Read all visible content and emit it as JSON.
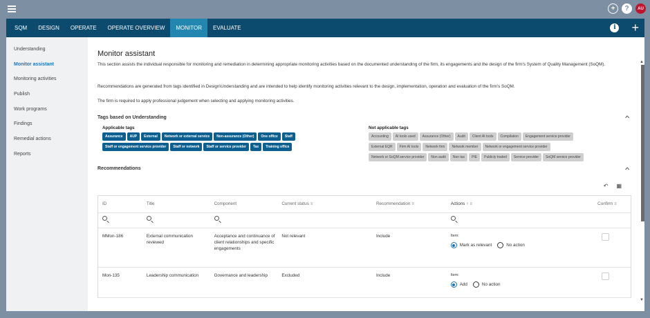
{
  "topbar": {
    "add_icon": "+",
    "help_icon": "?",
    "user_initials": "AU"
  },
  "nav": {
    "tabs": [
      "SQM",
      "DESIGN",
      "OPERATE",
      "OPERATE OVERVIEW",
      "MONITOR",
      "EVALUATE"
    ],
    "active_tab": "MONITOR",
    "info_icon": "i",
    "plus_icon": "+"
  },
  "sidebar": {
    "items": [
      "Understanding",
      "Monitor assistant",
      "Monitoring activities",
      "Publish",
      "Work programs",
      "Findings",
      "Remedial actions",
      "Reports"
    ],
    "active_item": "Monitor assistant"
  },
  "page": {
    "title": "Monitor assistant",
    "para1": "This section assists the individual responsible for monitoring and remediation in determining appropriate monitoring activities based on the documented understanding of the firm, its engagements and the design of the firm's System of Quality Management (SoQM).",
    "para2": "Recommendations are generated from tags identified in Design\\Understanding and are intended to help identify monitoring activities relevant to the design, implementation, operation and evaluation of the firm's SoQM.",
    "para3": "The firm is required to apply professional judgement when selecting and applying monitoring activities."
  },
  "tags": {
    "section_title": "Tags based on Understanding",
    "applicable_label": "Applicable tags",
    "applicable_row1": [
      "Assurance",
      "AUP",
      "External",
      "Network or external service",
      "Non-assurance (Other)",
      "One office",
      "Staff"
    ],
    "applicable_row2": [
      "Staff or engagement service provider",
      "Staff or network",
      "Staff or service provider",
      "Tax",
      "Training office"
    ],
    "not_applicable_label": "Not applicable tags",
    "na_row1": [
      "Accounting",
      "AI tools used",
      "Assurance (Other)",
      "Audit",
      "Client AI tools",
      "Compilation",
      "Engagement service provider"
    ],
    "na_row2": [
      "External EQR",
      "Firm AI tools",
      "Network firm",
      "Network member",
      "Network or engagement service provider"
    ],
    "na_row3": [
      "Network or SoQM service provider",
      "Non audit",
      "Non tax",
      "PIE",
      "Publicly traded",
      "Service provider",
      "SoQM service provider"
    ]
  },
  "recommendations": {
    "section_title": "Recommendations",
    "columns": {
      "id": "ID",
      "title": "Title",
      "component": "Component",
      "status": "Current status",
      "recommendation": "Recommendation",
      "actions": "Actions",
      "confirm": "Confirm"
    },
    "rows": [
      {
        "id": "MMon-186",
        "title": "External communication reviewed",
        "component": "Acceptance and continuance of client relationships and specific engagements",
        "status": "Not relevant",
        "recommendation": "Include",
        "item_label": "Item:",
        "option1": "Mark as relevant",
        "option2": "No action"
      },
      {
        "id": "Mon-135",
        "title": "Leadership communication",
        "component": "Governance and leadership",
        "status": "Excluded",
        "recommendation": "Include",
        "item_label": "Item:",
        "option1": "Add",
        "option2": "No action"
      }
    ]
  },
  "colors": {
    "navbar": "#0c4a6e",
    "active_tab": "#2386b0",
    "applicable_tag": "#0c5f8f",
    "not_applicable_tag": "#cfcfcf",
    "accent": "#1f73b7",
    "user_badge": "#c0152f"
  }
}
